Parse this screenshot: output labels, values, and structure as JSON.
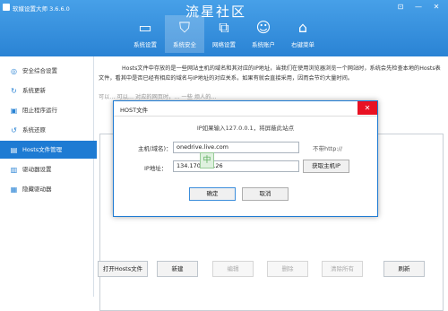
{
  "app": {
    "title": "软媒设置大师 3.6.6.0",
    "watermark": "流星社区",
    "window_controls": [
      "⊡",
      "—",
      "✕"
    ]
  },
  "toolbar": [
    {
      "label": "系统设置",
      "icon": "monitor-icon",
      "glyph": "▭",
      "active": false
    },
    {
      "label": "系统安全",
      "icon": "shield-icon",
      "glyph": "⛉",
      "active": true
    },
    {
      "label": "网络设置",
      "icon": "network-icon",
      "glyph": "⧉",
      "active": false
    },
    {
      "label": "系统账户",
      "icon": "user-icon",
      "glyph": "☺",
      "active": false
    },
    {
      "label": "右键菜单",
      "icon": "mouse-icon",
      "glyph": "⌂",
      "active": false
    }
  ],
  "sidebar": [
    {
      "label": "安全综合设置",
      "icon": "shield-check-icon",
      "glyph": "◎",
      "active": false
    },
    {
      "label": "系统更新",
      "icon": "refresh-icon",
      "glyph": "↻",
      "active": false
    },
    {
      "label": "阻止程序运行",
      "icon": "block-icon",
      "glyph": "▣",
      "active": false
    },
    {
      "label": "系统还原",
      "icon": "restore-icon",
      "glyph": "↺",
      "active": false
    },
    {
      "label": "Hosts文件管理",
      "icon": "hosts-icon",
      "glyph": "▤",
      "active": true
    },
    {
      "label": "驱动器设置",
      "icon": "drive-icon",
      "glyph": "▥",
      "active": false
    },
    {
      "label": "隐藏驱动器",
      "icon": "hide-drive-icon",
      "glyph": "▦",
      "active": false
    }
  ],
  "content": {
    "description": "Hosts文件中存放的是一些网站主机的域名和其对应的IP地址，当我们在使用浏览器浏览一个网站时，系统会先检查本地的Hosts表文件，看其中是否已经有相应的域名与IP地址的对应关系，如果有就会直接采用，因而会节约大量时间。",
    "description_faded": "可以… 可以… 对应的网页时，… 一些 烦人的…"
  },
  "buttons": [
    {
      "label": "打开Hosts文件",
      "enabled": true
    },
    {
      "label": "新建",
      "enabled": true
    },
    {
      "label": "编辑",
      "enabled": false
    },
    {
      "label": "删除",
      "enabled": false
    },
    {
      "label": "清除所有",
      "enabled": false
    },
    {
      "label": "刷新",
      "enabled": true
    }
  ],
  "dialog": {
    "title": "HOST文件",
    "close_glyph": "✕",
    "hint": "IP如果输入127.0.0.1，将屏蔽此站点",
    "host_label": "主机(域名)：",
    "host_value": "onedrive.live.com",
    "host_note": "不带http://",
    "ip_label": "IP地址：",
    "ip_value": "134.170.108.26",
    "get_ip_label": "获取主机IP",
    "ok_label": "确定",
    "cancel_label": "取消"
  }
}
